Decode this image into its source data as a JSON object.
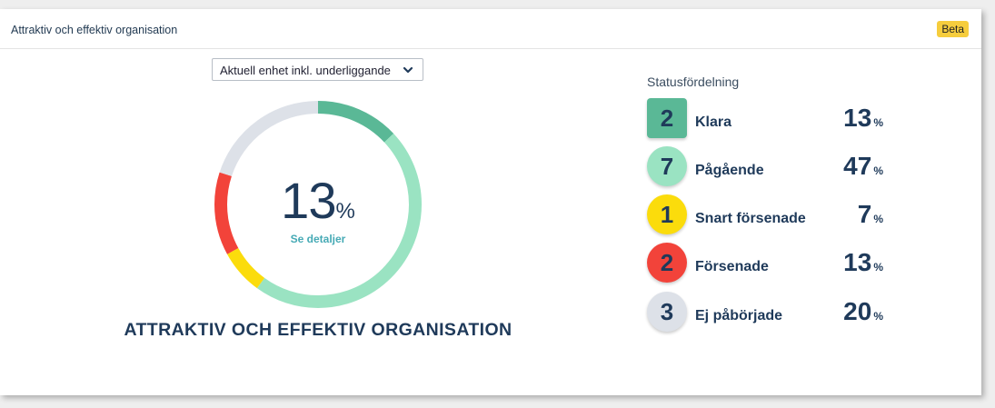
{
  "header": {
    "title": "Attraktiv och effektiv organisation",
    "badge": "Beta"
  },
  "filter": {
    "selected": "Aktuell enhet inkl. underliggande"
  },
  "summary": {
    "value": "13",
    "unit": "%",
    "link": "Se detaljer",
    "title": "ATTRAKTIV OCH EFFEKTIV ORGANISATION"
  },
  "colors": {
    "done": "#5ab896",
    "in_progress": "#9ae3c2",
    "soon_late": "#fbdc0c",
    "late": "#f2433a",
    "not_started": "#dde1e8"
  },
  "status": {
    "heading": "Statusfördelning",
    "items": [
      {
        "count": "2",
        "label": "Klara",
        "percent": "13",
        "unit": "%",
        "color": "#5ab896",
        "shape": "square"
      },
      {
        "count": "7",
        "label": "Pågående",
        "percent": "47",
        "unit": "%",
        "color": "#9ae3c2",
        "shape": "circle"
      },
      {
        "count": "1",
        "label": "Snart försenade",
        "percent": "7",
        "unit": "%",
        "color": "#fbdc0c",
        "shape": "circle"
      },
      {
        "count": "2",
        "label": "Försenade",
        "percent": "13",
        "unit": "%",
        "color": "#f2433a",
        "shape": "circle"
      },
      {
        "count": "3",
        "label": "Ej påbörjade",
        "percent": "20",
        "unit": "%",
        "color": "#dde1e8",
        "shape": "circle"
      }
    ]
  },
  "chart_data": {
    "type": "pie",
    "variant": "donut",
    "categories": [
      "Klara",
      "Pågående",
      "Snart försenade",
      "Försenade",
      "Ej påbörjade"
    ],
    "values": [
      13,
      47,
      7,
      13,
      20
    ],
    "counts": [
      2,
      7,
      1,
      2,
      3
    ],
    "colors": [
      "#5ab896",
      "#9ae3c2",
      "#fbdc0c",
      "#f2433a",
      "#dde1e8"
    ],
    "start": "top",
    "direction": "clockwise"
  }
}
